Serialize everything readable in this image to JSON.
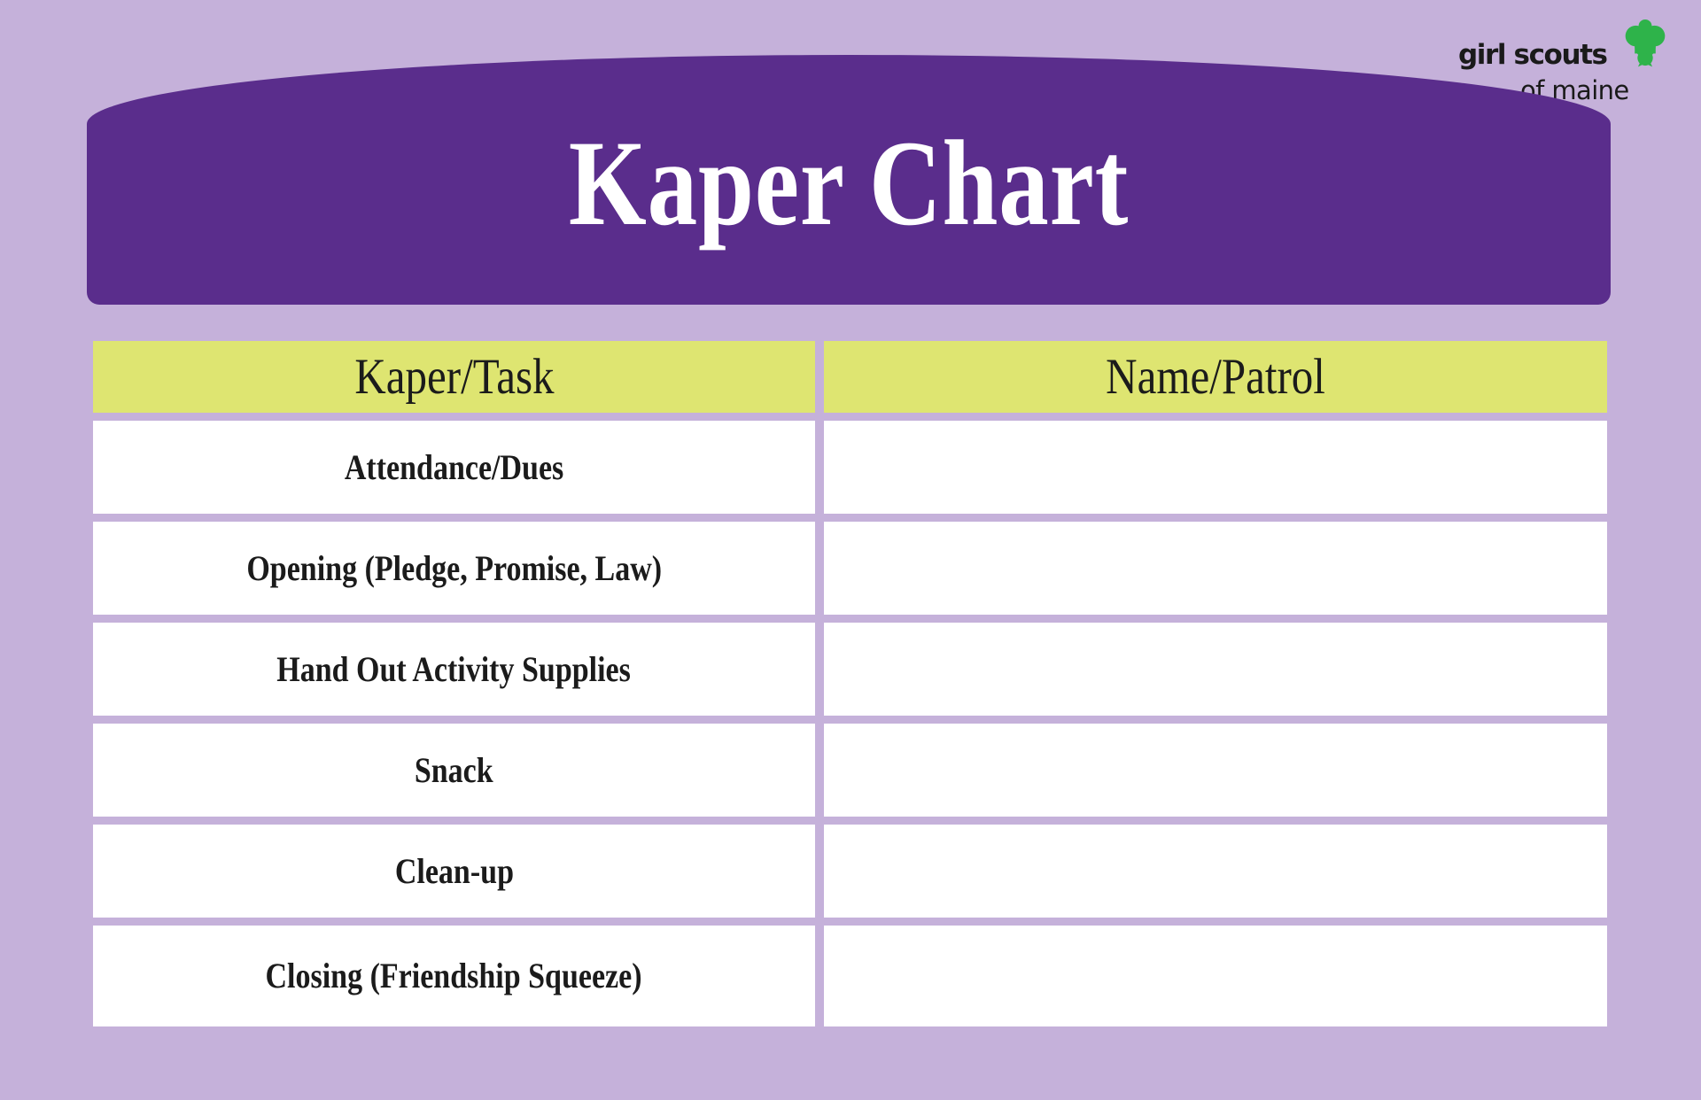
{
  "page": {
    "background_color": "#C5B1DA",
    "title": "Kaper Chart"
  },
  "logo": {
    "wordmark": "girl scouts",
    "subtitle": "of maine",
    "trefoil_color": "#2EB34A",
    "text_color": "#1A1A1A"
  },
  "banner": {
    "title": "Kaper Chart",
    "background_color": "#5A2D8C",
    "text_color": "#FFFFFF"
  },
  "table": {
    "header_background_color": "#DEE571",
    "row_background_color": "#FFFFFF",
    "grid_color": "#C5B1DA",
    "columns": [
      {
        "key": "task",
        "label": "Kaper/Task"
      },
      {
        "key": "name",
        "label": "Name/Patrol"
      }
    ],
    "rows": [
      {
        "task": "Attendance/Dues",
        "name": ""
      },
      {
        "task": "Opening (Pledge, Promise, Law)",
        "name": ""
      },
      {
        "task": "Hand Out Activity Supplies",
        "name": ""
      },
      {
        "task": "Snack",
        "name": ""
      },
      {
        "task": "Clean-up",
        "name": ""
      },
      {
        "task": "Closing (Friendship Squeeze)",
        "name": ""
      }
    ]
  }
}
